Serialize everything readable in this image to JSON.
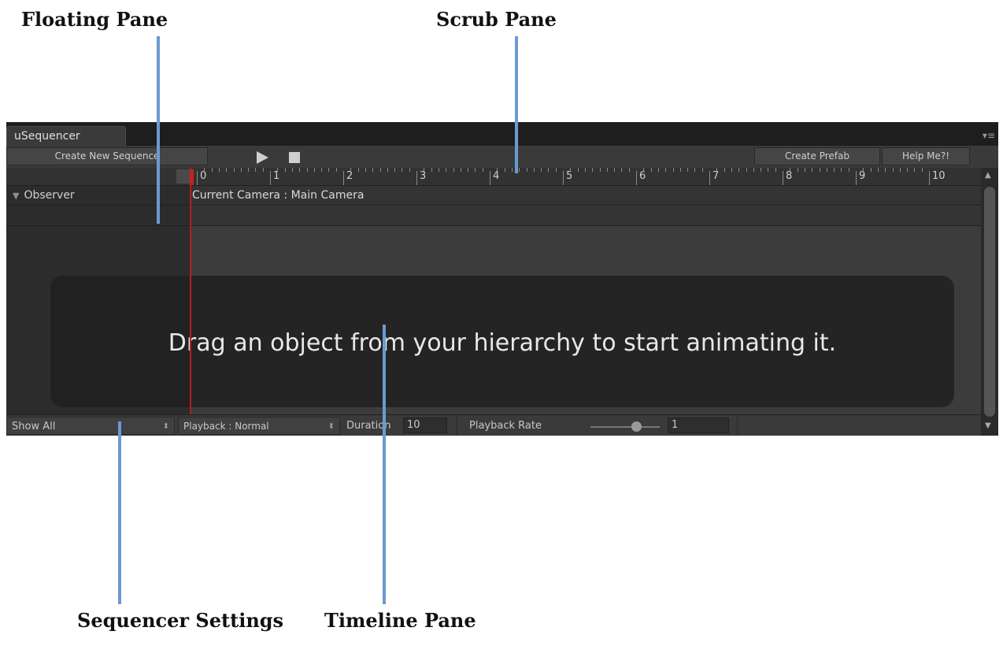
{
  "callouts": {
    "floating_pane": "Floating Pane",
    "scrub_pane": "Scrub Pane",
    "sequencer_settings": "Sequencer Settings",
    "timeline_pane": "Timeline Pane"
  },
  "window": {
    "tab_title": "uSequencer"
  },
  "toolbar": {
    "create_new_sequence": "Create New Sequence",
    "create_prefab": "Create Prefab",
    "help": "Help Me?!"
  },
  "ruler": {
    "ticks": [
      "0",
      "1",
      "2",
      "3",
      "4",
      "5",
      "6",
      "7",
      "8",
      "9",
      "10"
    ]
  },
  "tracks": {
    "observer_label": "Observer",
    "camera_label": "Current Camera : Main Camera"
  },
  "hint": "Drag an object from your hierarchy to start animating it.",
  "settings": {
    "show_all": "Show All",
    "playback": "Playback : Normal",
    "duration_label": "Duration",
    "duration_value": "10",
    "playback_rate_label": "Playback Rate",
    "playback_rate_value": "1"
  },
  "colors": {
    "callout_line": "#6a9bd0",
    "scrub_marker": "#c82020"
  }
}
